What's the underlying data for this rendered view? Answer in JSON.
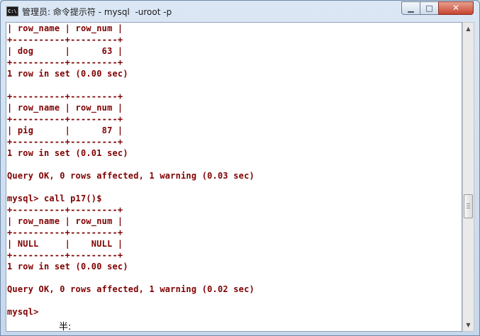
{
  "window": {
    "title": "管理员: 命令提示符 - mysql  -uroot -p",
    "icon": "cmd-icon",
    "app_icon_text": "C:\\",
    "controls": {
      "minimize": "▁",
      "maximize": "□",
      "close": "✕"
    }
  },
  "console": {
    "lines": [
      "| row_name | row_num |",
      "+----------+---------+",
      "| dog      |      63 |",
      "+----------+---------+",
      "1 row in set (0.00 sec)",
      "",
      "+----------+---------+",
      "| row_name | row_num |",
      "+----------+---------+",
      "| pig      |      87 |",
      "+----------+---------+",
      "1 row in set (0.01 sec)",
      "",
      "Query OK, 0 rows affected, 1 warning (0.03 sec)",
      "",
      "mysql> call p17()$",
      "+----------+---------+",
      "| row_name | row_num |",
      "+----------+---------+",
      "| NULL     |    NULL |",
      "+----------+---------+",
      "1 row in set (0.00 sec)",
      "",
      "Query OK, 0 rows affected, 1 warning (0.02 sec)",
      "",
      "mysql>"
    ],
    "ime_status": "半:",
    "text_color": "#800000",
    "background": "#ffffff"
  },
  "scrollbar": {
    "up_arrow": "▲",
    "down_arrow": "▼"
  }
}
